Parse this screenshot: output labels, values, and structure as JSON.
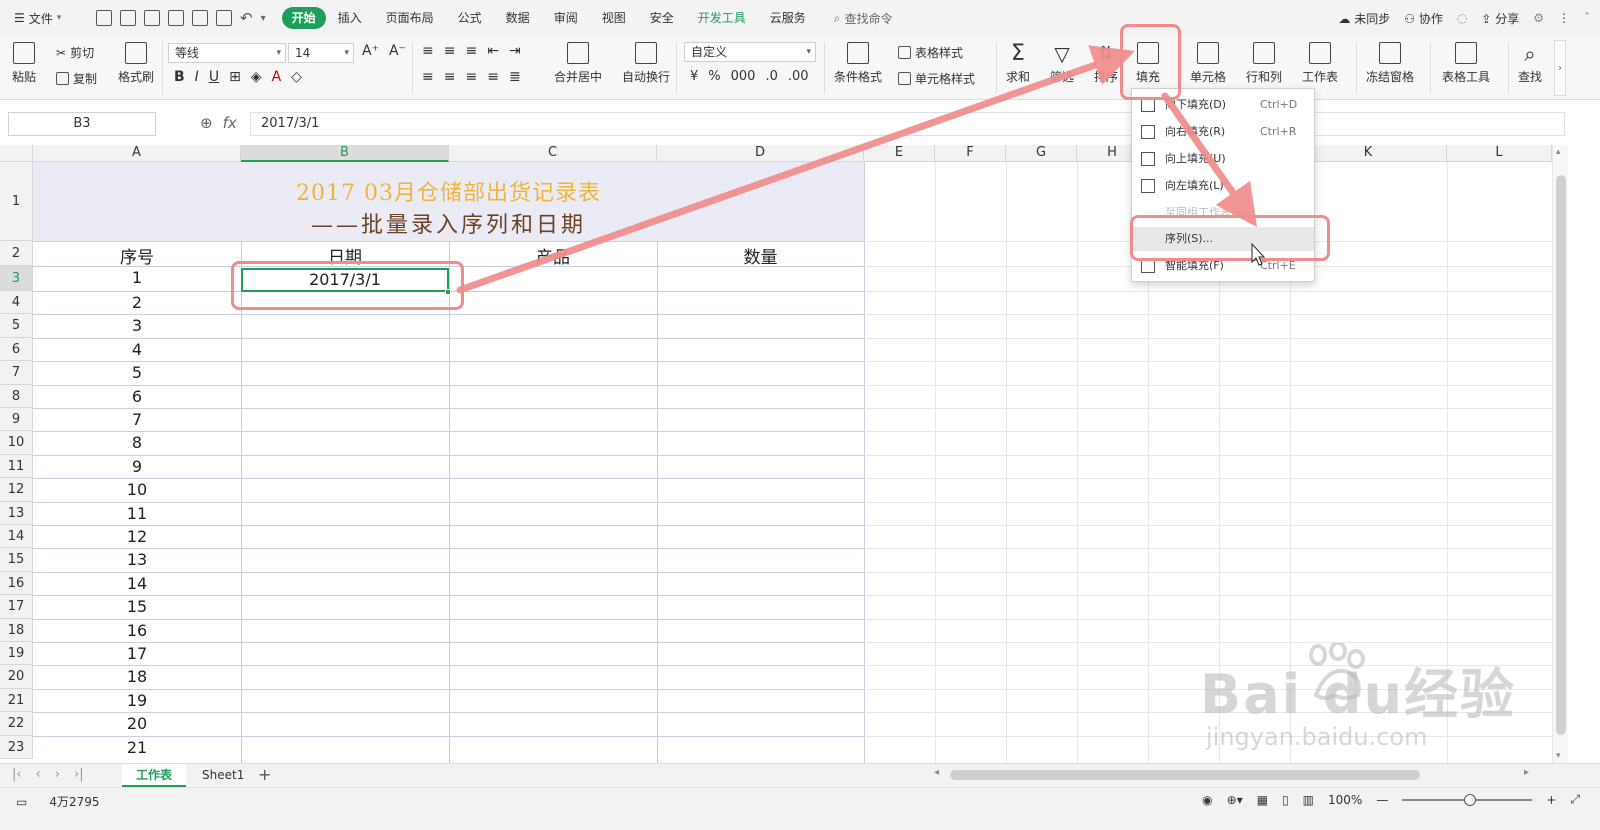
{
  "menubar": {
    "file_label": "文件",
    "tabs": [
      "开始",
      "插入",
      "页面布局",
      "公式",
      "数据",
      "审阅",
      "视图",
      "安全",
      "开发工具",
      "云服务"
    ],
    "active_tab": "开始",
    "search_cmd": "查找命令",
    "right_items": [
      "未同步",
      "协作",
      "分享"
    ]
  },
  "ribbon": {
    "paste": "粘贴",
    "cut": "剪切",
    "copy": "复制",
    "format_painter": "格式刷",
    "font_name": "等线",
    "font_size": "14",
    "merge_center": "合并居中",
    "auto_wrap": "自动换行",
    "number_format": "自定义",
    "conditional_format": "条件格式",
    "table_style": "表格样式",
    "cell_style": "单元格样式",
    "sum": "求和",
    "filter": "筛选",
    "sort": "排序",
    "fill": "填充",
    "cell": "单元格",
    "row_col": "行和列",
    "worksheet": "工作表",
    "freeze": "冻结窗格",
    "table_tools": "表格工具",
    "find": "查找"
  },
  "formula_bar": {
    "name_box": "B3",
    "fx": "fx",
    "value": "2017/3/1"
  },
  "sheet": {
    "columns": [
      "A",
      "B",
      "C",
      "D",
      "E",
      "F",
      "G",
      "H",
      "I",
      "J",
      "K",
      "L"
    ],
    "rows": [
      "1",
      "2",
      "3",
      "4",
      "5",
      "6",
      "7",
      "8",
      "9",
      "10",
      "11",
      "12",
      "13",
      "14",
      "15",
      "16",
      "17",
      "18",
      "19",
      "20",
      "21",
      "22",
      "23"
    ],
    "title_line1": "2017 03月仓储部出货记录表",
    "title_line2": "——批量录入序列和日期",
    "headers": [
      "序号",
      "日期",
      "产品",
      "数量"
    ],
    "serials": [
      "1",
      "2",
      "3",
      "4",
      "5",
      "6",
      "7",
      "8",
      "9",
      "10",
      "11",
      "12",
      "13",
      "14",
      "15",
      "16",
      "17",
      "18",
      "19",
      "20",
      "21"
    ],
    "date_b3": "2017/3/1"
  },
  "fill_menu": {
    "items": [
      {
        "label": "向下填充(D)",
        "shortcut": "Ctrl+D"
      },
      {
        "label": "向右填充(R)",
        "shortcut": "Ctrl+R"
      },
      {
        "label": "向上填充(U)",
        "shortcut": ""
      },
      {
        "label": "向左填充(L)",
        "shortcut": ""
      },
      {
        "label": "至同组工作表(A)...",
        "shortcut": ""
      },
      {
        "label": "序列(S)...",
        "shortcut": ""
      },
      {
        "label": "智能填充(F)",
        "shortcut": "Ctrl+E"
      }
    ]
  },
  "sheet_tabs": {
    "tabs": [
      "工作表",
      "Sheet1"
    ],
    "active": "工作表",
    "add": "+"
  },
  "status": {
    "word_count": "4万2795",
    "zoom": "100%"
  },
  "watermark": {
    "brand": "Bai du经验",
    "url": "jingyan.baidu.com"
  },
  "colors": {
    "accent": "#1d9e5a",
    "annotation": "#f08c8c",
    "title_gold": "#f0b43a",
    "title_brown": "#6b4226"
  }
}
